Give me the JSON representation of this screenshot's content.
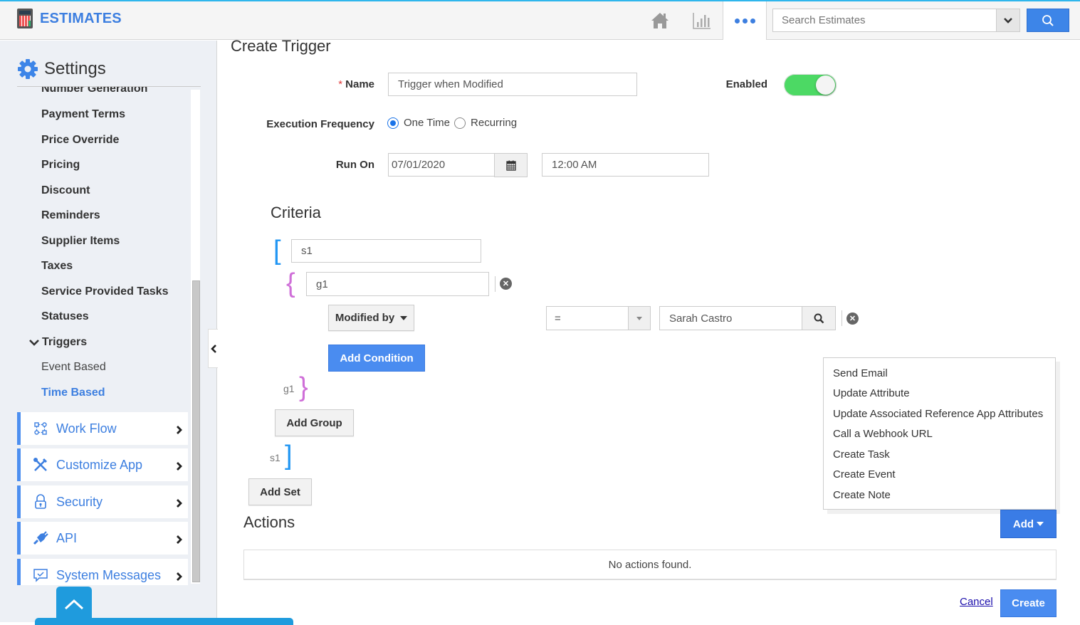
{
  "app": {
    "title": "ESTIMATES",
    "search_placeholder": "Search Estimates",
    "header_icons": [
      "home-icon",
      "chart-icon",
      "more-icon",
      "search-icon"
    ]
  },
  "sidebar": {
    "title": "Settings",
    "sub_items": [
      {
        "label": "Number Generation",
        "style": "bold"
      },
      {
        "label": "Payment Terms",
        "style": "bold"
      },
      {
        "label": "Price Override",
        "style": "bold"
      },
      {
        "label": "Pricing",
        "style": "bold"
      },
      {
        "label": "Discount",
        "style": "bold"
      },
      {
        "label": "Reminders",
        "style": "bold"
      },
      {
        "label": "Supplier Items",
        "style": "bold"
      },
      {
        "label": "Taxes",
        "style": "bold"
      },
      {
        "label": "Service Provided Tasks",
        "style": "bold"
      },
      {
        "label": "Statuses",
        "style": "bold"
      },
      {
        "label": "Triggers",
        "style": "bold",
        "expanded": true
      },
      {
        "label": "Event Based",
        "style": "plain"
      },
      {
        "label": "Time Based",
        "style": "active"
      }
    ],
    "nav_cards": [
      {
        "label": "Work Flow",
        "icon": "workflow-icon"
      },
      {
        "label": "Customize App",
        "icon": "tools-icon"
      },
      {
        "label": "Security",
        "icon": "lock-icon"
      },
      {
        "label": "API",
        "icon": "plug-icon"
      },
      {
        "label": "System Messages",
        "icon": "message-icon"
      }
    ]
  },
  "form": {
    "page_title": "Create Trigger",
    "name_label": "Name",
    "required_mark": "*",
    "name_value": "Trigger when Modified",
    "enabled_label": "Enabled",
    "enabled": true,
    "frequency_label": "Execution Frequency",
    "frequency_options": [
      "One Time",
      "Recurring"
    ],
    "frequency_selected": "One Time",
    "run_on_label": "Run On",
    "run_on_date": "07/01/2020",
    "run_on_time": "12:00 AM"
  },
  "criteria": {
    "title": "Criteria",
    "set_name": "s1",
    "group_name": "g1",
    "condition": {
      "field": "Modified by",
      "operator": "=",
      "value": "Sarah Castro"
    },
    "add_condition_label": "Add Condition",
    "group_close_label": "g1",
    "add_group_label": "Add Group",
    "set_close_label": "s1",
    "add_set_label": "Add Set"
  },
  "actions": {
    "title": "Actions",
    "add_label": "Add",
    "menu_items": [
      "Send Email",
      "Update Attribute",
      "Update Associated Reference App Attributes",
      "Call a Webhook URL",
      "Create Task",
      "Create Event",
      "Create Note"
    ],
    "empty_text": "No actions found."
  },
  "footer": {
    "cancel_label": "Cancel",
    "create_label": "Create"
  }
}
